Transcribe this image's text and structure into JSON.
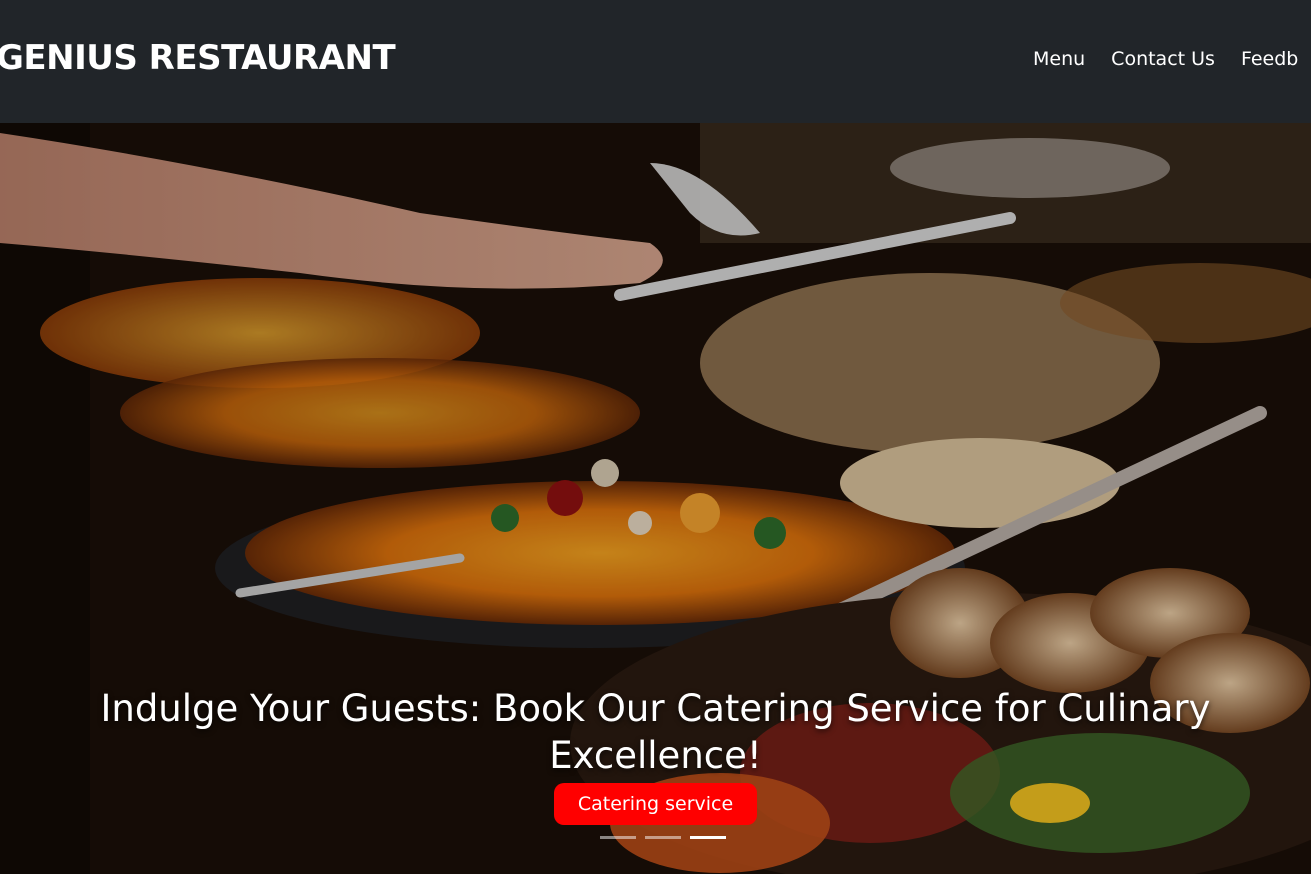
{
  "navbar": {
    "brand": "GENIUS RESTAURANT",
    "links": [
      "Menu",
      "Contact Us",
      "Feedb"
    ]
  },
  "hero": {
    "image_description_icon": "catering-buffet-photo",
    "title": "Indulge Your Guests: Book Our Catering Service for Culinary Excellence!",
    "cta_label": "Catering service",
    "slides": 3,
    "active_slide": 3
  },
  "colors": {
    "navbar_bg": "#212529",
    "cta_bg": "#ff0000",
    "text": "#ffffff"
  }
}
